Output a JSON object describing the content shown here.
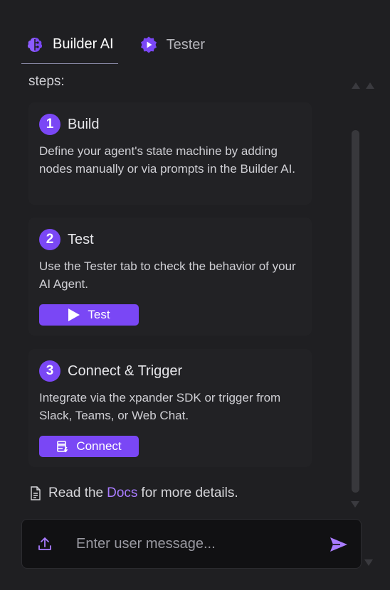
{
  "tabs": [
    {
      "label": "Builder AI",
      "icon": "brain-circuit-icon",
      "active": true
    },
    {
      "label": "Tester",
      "icon": "play-badge-icon",
      "active": false
    }
  ],
  "steps_heading": "steps:",
  "steps": [
    {
      "number": "1",
      "title": "Build",
      "description": "Define your agent's state machine by adding nodes manually or via prompts in the Builder AI."
    },
    {
      "number": "2",
      "title": "Test",
      "description": "Use the Tester tab to check the behavior of your AI Agent.",
      "button_label": "Test",
      "button_icon": "play-icon"
    },
    {
      "number": "3",
      "title": "Connect & Trigger",
      "description": "Integrate via the xpander SDK or trigger from Slack, Teams, or Web Chat.",
      "button_label": "Connect",
      "button_icon": "connect-icon"
    }
  ],
  "docs": {
    "prefix": "Read the",
    "link": "Docs",
    "suffix": "for more details.",
    "icon": "document-icon"
  },
  "composer": {
    "placeholder": "Enter user message...",
    "upload_icon": "upload-icon",
    "send_icon": "send-icon"
  },
  "colors": {
    "accent": "#7a47f5",
    "link": "#a97cff",
    "background": "#1f1f22",
    "card": "#222225",
    "input": "#111113"
  }
}
